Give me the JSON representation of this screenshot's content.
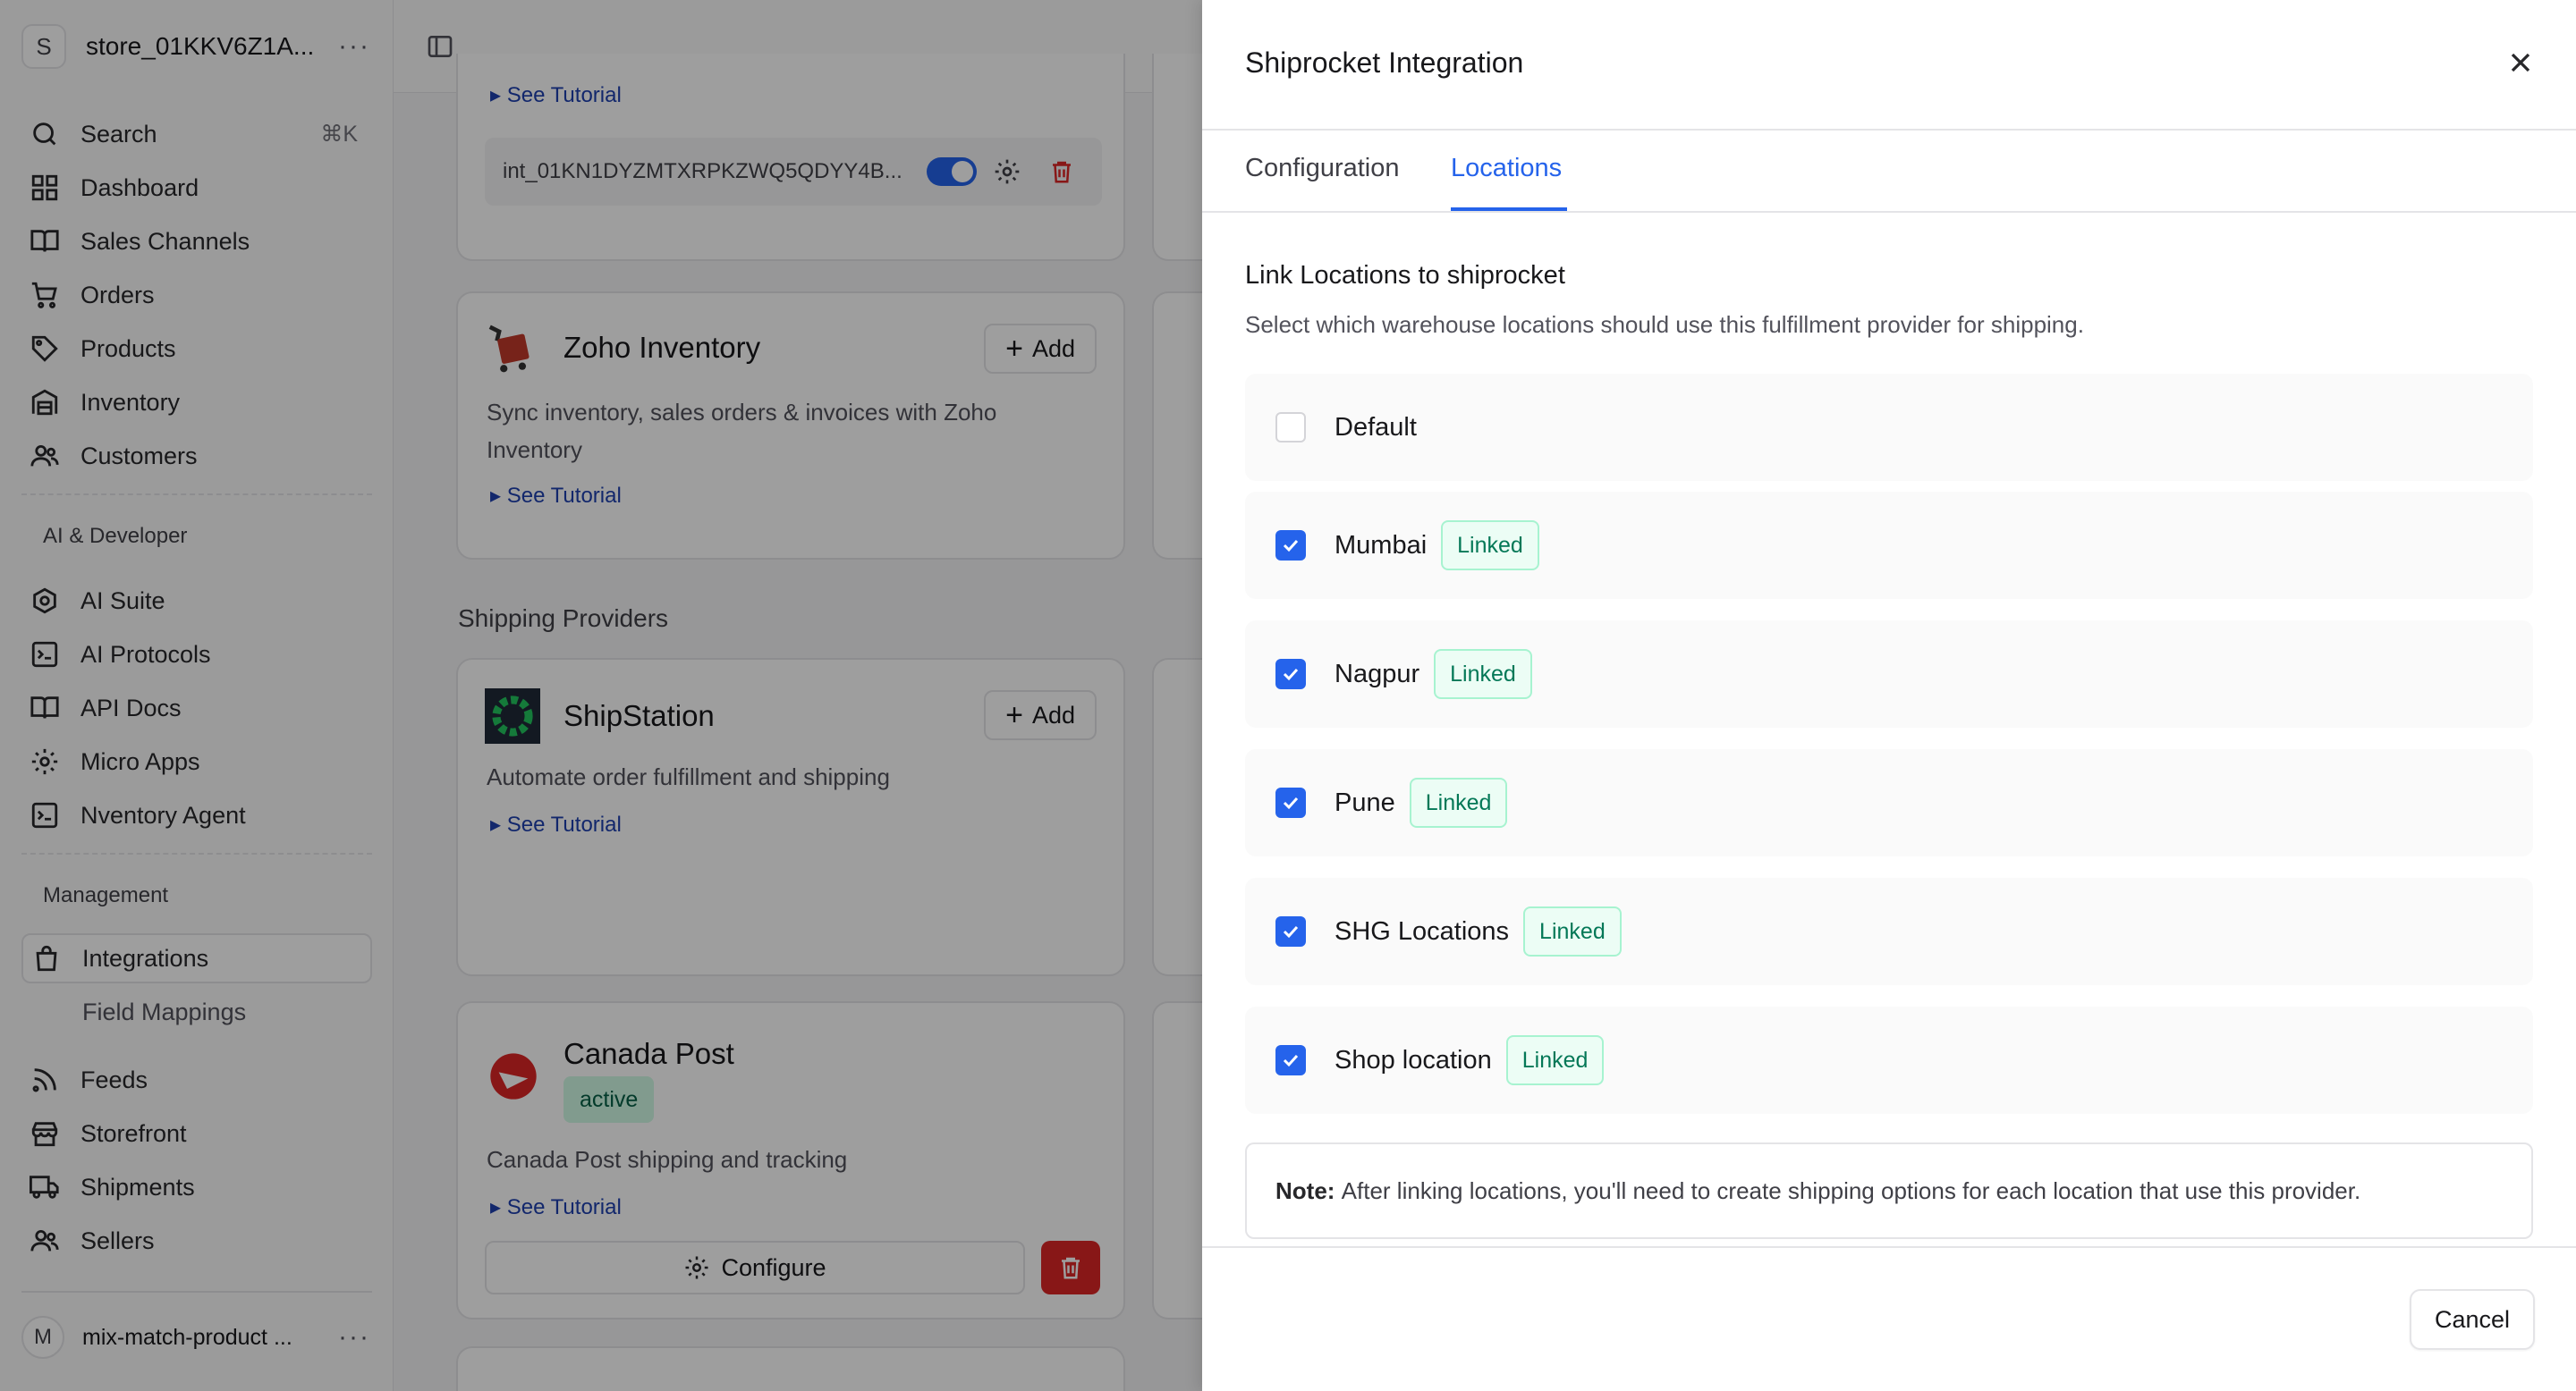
{
  "sidebar": {
    "store": {
      "initial": "S",
      "name": "store_01KKV6Z1A..."
    },
    "search": {
      "label": "Search",
      "shortcut": "⌘K"
    },
    "items": [
      {
        "label": "Dashboard",
        "icon": "dashboard-icon"
      },
      {
        "label": "Sales Channels",
        "icon": "book-open-icon"
      },
      {
        "label": "Orders",
        "icon": "cart-icon"
      },
      {
        "label": "Products",
        "icon": "tag-icon"
      },
      {
        "label": "Inventory",
        "icon": "warehouse-icon"
      },
      {
        "label": "Customers",
        "icon": "users-icon"
      }
    ],
    "ai_section_label": "AI & Developer",
    "ai_items": [
      {
        "label": "AI Suite",
        "icon": "ai-suite-icon"
      },
      {
        "label": "AI Protocols",
        "icon": "terminal-icon"
      },
      {
        "label": "API Docs",
        "icon": "book-icon"
      },
      {
        "label": "Micro Apps",
        "icon": "gear-icon"
      },
      {
        "label": "Nventory Agent",
        "icon": "terminal-icon"
      }
    ],
    "management_section_label": "Management",
    "management_items": [
      {
        "label": "Integrations",
        "icon": "shopping-bag-icon"
      },
      {
        "label": "Field Mappings"
      },
      {
        "label": "Feeds",
        "icon": "rss-icon"
      },
      {
        "label": "Storefront",
        "icon": "store-icon"
      },
      {
        "label": "Shipments",
        "icon": "truck-icon"
      },
      {
        "label": "Sellers",
        "icon": "users-icon"
      }
    ],
    "footer": {
      "initial": "M",
      "name": "mix-match-product ..."
    }
  },
  "background": {
    "integration_id": "int_01KN1DYZMTXRPKZWQ5QDYY4B...",
    "tutorial_label": "See Tutorial",
    "add_label": "Add",
    "zoho": {
      "title": "Zoho Inventory",
      "desc": "Sync inventory, sales orders & invoices with Zoho Inventory"
    },
    "shipping_heading": "Shipping Providers",
    "shipstation": {
      "title": "ShipStation",
      "desc": "Automate order fulfillment and shipping"
    },
    "canada_post": {
      "title": "Canada Post",
      "status": "active",
      "desc": "Canada Post shipping and tracking",
      "configure_label": "Configure"
    }
  },
  "dialog": {
    "title": "Shiprocket Integration",
    "tabs": [
      "Configuration",
      "Locations"
    ],
    "active_tab": "Locations",
    "heading": "Link Locations to shiprocket",
    "subheading": "Select which warehouse locations should use this fulfillment provider for shipping.",
    "locations": [
      {
        "name": "Default",
        "checked": false,
        "badge": ""
      },
      {
        "name": "Mumbai",
        "checked": true,
        "badge": "Linked"
      },
      {
        "name": "Nagpur",
        "checked": true,
        "badge": "Linked"
      },
      {
        "name": "Pune",
        "checked": true,
        "badge": "Linked"
      },
      {
        "name": "SHG Locations",
        "checked": true,
        "badge": "Linked"
      },
      {
        "name": "Shop location",
        "checked": true,
        "badge": "Linked"
      }
    ],
    "note_label": "Note:",
    "note_text": "After linking locations, you'll need to create shipping options for each location that use this provider.",
    "cancel_label": "Cancel"
  },
  "colors": {
    "accent": "#2563eb",
    "linked_bg": "#ecfdf5",
    "linked_text": "#047857",
    "danger": "#dc2626"
  }
}
